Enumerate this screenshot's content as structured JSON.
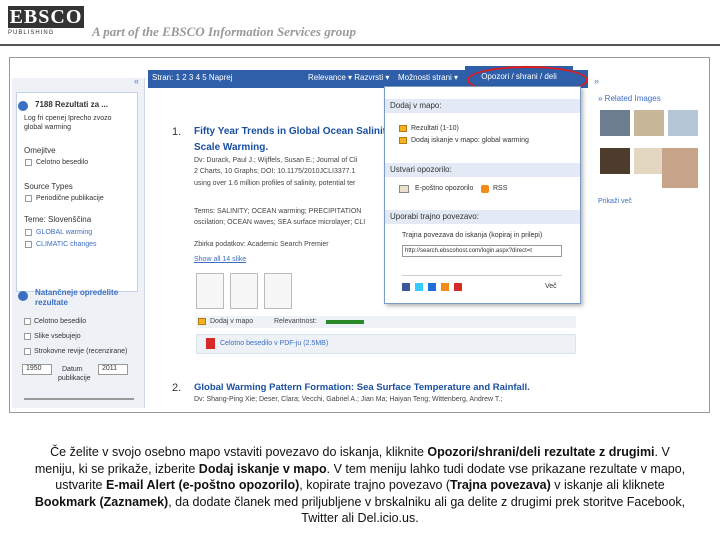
{
  "header": {
    "logo": "EBSCO",
    "logo_sub": "PUBLISHING",
    "tagline": "A part of the EBSCO Information Services group"
  },
  "toolbar": {
    "pages": "Stran: 1 2 3 4 5 Naprej",
    "sort": "Relevance ▾ Razvrsti ▾",
    "options": "Možnosti strani ▾",
    "share_tab": "Opozori / shrani / deli",
    "collapse": "«",
    "expand": "»"
  },
  "left_pane": {
    "results": "7188 Rezultati za ...",
    "login_note_1": "Log fri cpenej Iprecho zvozo",
    "login_note_2": "global warming",
    "omejitve": "Omejitve",
    "full_text": "Celotno besedilo",
    "source_types": "Source Types",
    "periodic": "Periodične publikacije",
    "subjects": "Teme: Slovenščina",
    "subj1": "GLOBAL warming",
    "subj2": "CLIMATIC changes",
    "refine_1": "Natančneje opredelite",
    "refine_2": "rezultate",
    "f1": "Celotno besedilo",
    "f2": "Slike vsebujejo",
    "f3": "Strokovne revije (recenzirane)",
    "year_from": "1950",
    "year_to": "2011",
    "pub_date_1": "Datum",
    "pub_date_2": "publikacije"
  },
  "results": [
    {
      "num": "1.",
      "title_1": "Fifty Year Trends in Global Ocean Salinit",
      "title_2": "Scale Warming.",
      "lines": [
        "Dv: Durack, Paul J.; Wijffels, Susan E.; Journal of Cli",
        "2 Charts, 10 Graphs; DOI: 10.1175/2010JCLI3377.1",
        "using over 1.6 million profiles of salinity, potential ter",
        "Terms: SALINITY; OCEAN warming; PRECIPITATION",
        "oscilation; OCEAN waves; SEA surface microlayer; CLI",
        "Zbirka podatkov: Academic Search Premier"
      ],
      "more": "Show all 14 slike",
      "add_folder": "Dodaj v mapo",
      "relevance": "Relevantnost:",
      "pdf": "Celotno besedilo v PDF-ju (2.5MB)"
    },
    {
      "num": "2.",
      "title": "Global Warming Pattern Formation: Sea Surface Temperature and Rainfall.",
      "line": "Dv: Shang-Ping Xie; Deser, Clara; Vecchi, Gabriel A.; Jian Ma; Haiyan Teng; Wittenberg, Andrew T.;"
    }
  ],
  "dropdown": {
    "h1": "Dodaj v mapo:",
    "i1": "Rezultati (1-10)",
    "i2": "Dodaj iskanje v mapo: global warming",
    "h2": "Ustvari opozorilo:",
    "i3": "E-poštno opozorilo",
    "i4": "RSS",
    "h3": "Uporabi trajno povezavo:",
    "i5": "Trajna povezava do iskanja (kopiraj in prilepi)",
    "url": "http://search.ebscohost.com/login.aspx?direct=t",
    "more": "Več"
  },
  "right_pane": {
    "title": "» Related Images",
    "more": "Prikaži več"
  },
  "caption": {
    "p1": "Če želite v svojo osebno mapo vstaviti povezavo do iskanja, kliknite ",
    "b1": "Opozori/shrani/deli rezultate z drugimi",
    "p2": ". V meniju, ki se prikaže, izberite ",
    "b2": "Dodaj iskanje v mapo",
    "p3": ". V tem meniju lahko tudi dodate vse prikazane rezultate v mapo, ustvarite ",
    "b3": "E-mail Alert (e-poštno opozorilo)",
    "p4": ", kopirate trajno povezavo (",
    "b4": "Trajna povezava)",
    "p5": " v iskanje ali kliknete ",
    "b5": "Bookmark (Zaznamek)",
    "p6": ", da dodate članek med priljubljene v brskalniku ali ga delite z drugimi prek storitve Facebook, Twitter ali Del.icio.us."
  },
  "colors": {
    "accent": "#2f5fa8",
    "highlight": "#e01b1b",
    "link": "#1a4fa0"
  }
}
